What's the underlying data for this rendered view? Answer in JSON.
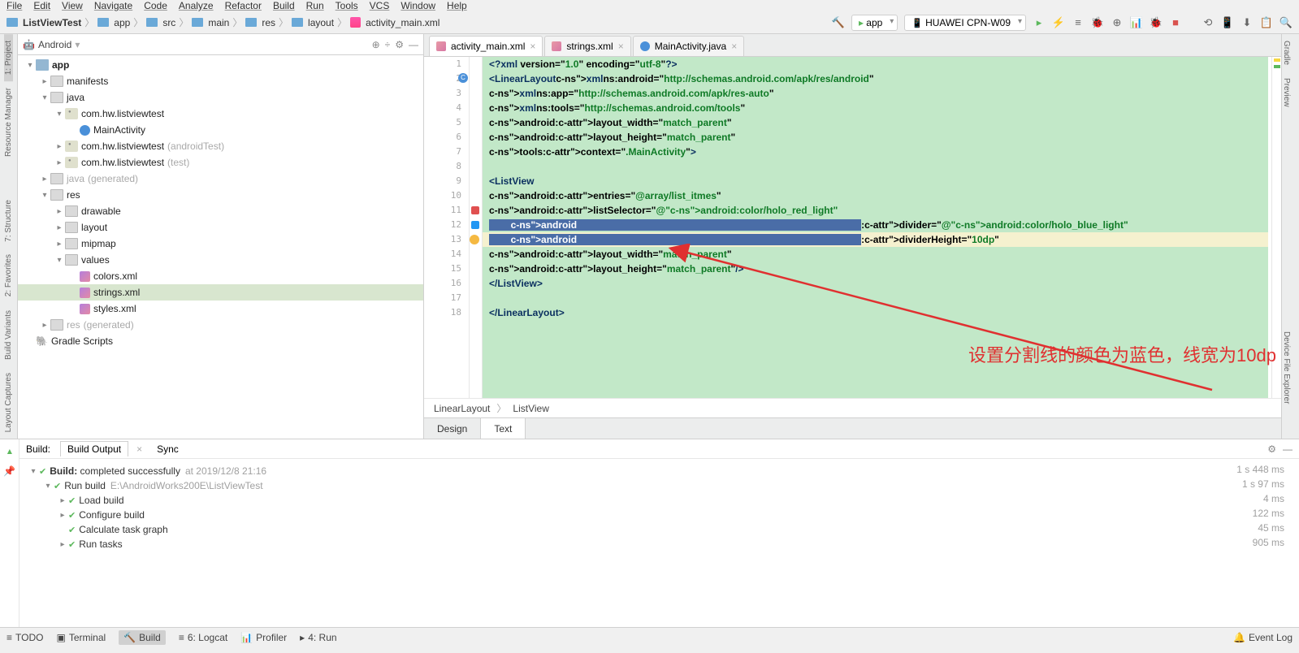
{
  "menu": [
    "File",
    "Edit",
    "View",
    "Navigate",
    "Code",
    "Analyze",
    "Refactor",
    "Build",
    "Run",
    "Tools",
    "VCS",
    "Window",
    "Help"
  ],
  "breadcrumb": {
    "items": [
      "ListViewTest",
      "app",
      "src",
      "main",
      "res",
      "layout",
      "activity_main.xml"
    ]
  },
  "toolbar": {
    "run_config": "app",
    "device": "HUAWEI CPN-W09"
  },
  "project": {
    "title": "Android",
    "tree": [
      {
        "d": 0,
        "a": "▾",
        "i": "folder",
        "l": "app",
        "b": true
      },
      {
        "d": 1,
        "a": "▸",
        "i": "folder-o",
        "l": "manifests"
      },
      {
        "d": 1,
        "a": "▾",
        "i": "folder-o",
        "l": "java"
      },
      {
        "d": 2,
        "a": "▾",
        "i": "pkg",
        "l": "com.hw.listviewtest"
      },
      {
        "d": 3,
        "a": "",
        "i": "cls",
        "l": "MainActivity"
      },
      {
        "d": 2,
        "a": "▸",
        "i": "pkg",
        "l": "com.hw.listviewtest",
        "h": "(androidTest)"
      },
      {
        "d": 2,
        "a": "▸",
        "i": "pkg",
        "l": "com.hw.listviewtest",
        "h": "(test)"
      },
      {
        "d": 1,
        "a": "▸",
        "i": "folder-o",
        "l": "java",
        "h": "(generated)",
        "dim": true
      },
      {
        "d": 1,
        "a": "▾",
        "i": "folder-o",
        "l": "res"
      },
      {
        "d": 2,
        "a": "▸",
        "i": "folder-o",
        "l": "drawable"
      },
      {
        "d": 2,
        "a": "▸",
        "i": "folder-o",
        "l": "layout"
      },
      {
        "d": 2,
        "a": "▸",
        "i": "folder-o",
        "l": "mipmap"
      },
      {
        "d": 2,
        "a": "▾",
        "i": "folder-o",
        "l": "values"
      },
      {
        "d": 3,
        "a": "",
        "i": "xml",
        "l": "colors.xml"
      },
      {
        "d": 3,
        "a": "",
        "i": "xml",
        "l": "strings.xml",
        "sel": true
      },
      {
        "d": 3,
        "a": "",
        "i": "xml",
        "l": "styles.xml"
      },
      {
        "d": 1,
        "a": "▸",
        "i": "folder-o",
        "l": "res",
        "h": "(generated)",
        "dim": true
      },
      {
        "d": 0,
        "a": "",
        "i": "folder-o",
        "l": "Gradle Scripts",
        "elephant": true
      }
    ]
  },
  "editor": {
    "tabs": [
      {
        "icon": "xml",
        "label": "activity_main.xml",
        "active": true
      },
      {
        "icon": "xml",
        "label": "strings.xml"
      },
      {
        "icon": "java",
        "label": "MainActivity.java"
      }
    ],
    "breadcrumb": [
      "LinearLayout",
      "ListView"
    ],
    "modes": [
      {
        "label": "Design"
      },
      {
        "label": "Text",
        "active": true
      }
    ],
    "lines": [
      "<?xml version=\"1.0\" encoding=\"utf-8\"?>",
      "<LinearLayout xmlns:android=\"http://schemas.android.com/apk/res/android\"",
      "    xmlns:app=\"http://schemas.android.com/apk/res-auto\"",
      "    xmlns:tools=\"http://schemas.android.com/tools\"",
      "    android:layout_width=\"match_parent\"",
      "    android:layout_height=\"match_parent\"",
      "    tools:context=\".MainActivity\">",
      "",
      "    <ListView",
      "        android:entries=\"@array/list_itmes\"",
      "        android:listSelector=\"@android:color/holo_red_light\"",
      "        android:divider=\"@android:color/holo_blue_light\"",
      "        android:dividerHeight=\"10dp\"",
      "        android:layout_width=\"match_parent\"",
      "        android:layout_height=\"match_parent\"/>",
      "    </ListView>",
      "",
      "</LinearLayout>"
    ],
    "highlight_sel": [
      11,
      12
    ],
    "cur_line": 12,
    "annotation": "设置分割线的颜色为蓝色，线宽为10dp"
  },
  "build": {
    "header_label": "Build:",
    "tabs": [
      "Build Output",
      "Sync"
    ],
    "rows": [
      {
        "d": 0,
        "a": "▾",
        "ok": true,
        "txt": "Build:",
        "bold": "completed successfully",
        "dim": "at 2019/12/8 21:16",
        "time": "1 s 448 ms"
      },
      {
        "d": 1,
        "a": "▾",
        "ok": true,
        "txt": "Run build",
        "dim": "E:\\AndroidWorks200E\\ListViewTest",
        "time": "1 s 97 ms"
      },
      {
        "d": 2,
        "a": "▸",
        "ok": true,
        "txt": "Load build",
        "time": "4 ms"
      },
      {
        "d": 2,
        "a": "▸",
        "ok": true,
        "txt": "Configure build",
        "time": "122 ms"
      },
      {
        "d": 2,
        "a": "",
        "ok": true,
        "txt": "Calculate task graph",
        "time": "45 ms"
      },
      {
        "d": 2,
        "a": "▸",
        "ok": true,
        "txt": "Run tasks",
        "time": "905 ms"
      }
    ]
  },
  "status": {
    "left": [
      "TODO",
      "Terminal",
      "Build",
      "6: Logcat",
      "Profiler",
      "4: Run"
    ],
    "active": "Build",
    "right": "Event Log"
  },
  "rails": {
    "left": [
      "1: Project",
      "Resource Manager",
      "7: Structure",
      "2: Favorites",
      "Build Variants",
      "Layout Captures"
    ],
    "right": [
      "Gradle",
      "Preview",
      "Device File Explorer"
    ]
  }
}
